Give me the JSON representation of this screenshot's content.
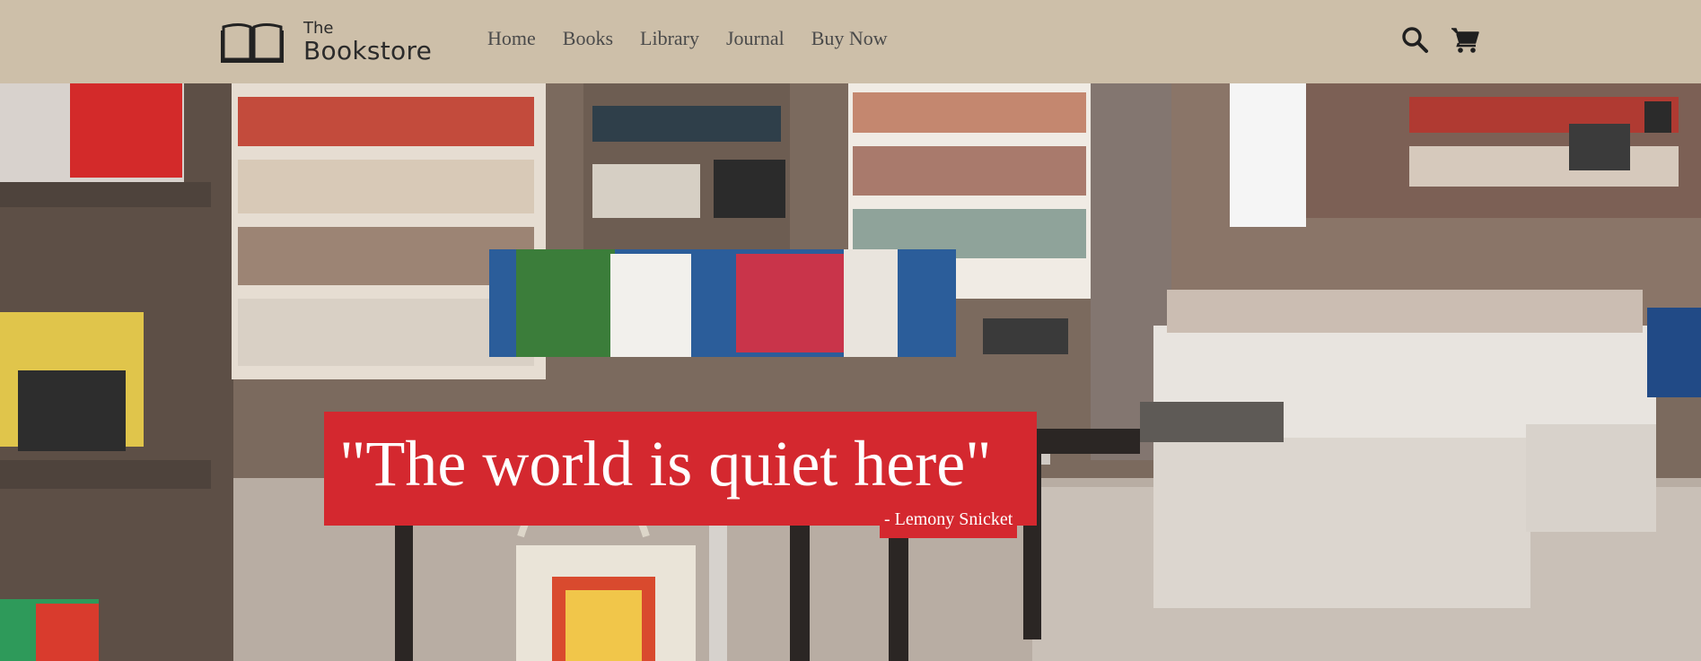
{
  "brand": {
    "small": "The",
    "big": "Bookstore"
  },
  "nav": {
    "items": [
      "Home",
      "Books",
      "Library",
      "Journal",
      "Buy Now"
    ]
  },
  "icons": [
    "book-logo-icon",
    "search-icon",
    "cart-icon"
  ],
  "hero": {
    "quote": "\"The world is quiet here\"",
    "author": "- Lemony Snicket"
  },
  "colors": {
    "header_bg": "#cdbfa9",
    "accent": "#d4282f",
    "text_dark": "#2b2b2b"
  }
}
